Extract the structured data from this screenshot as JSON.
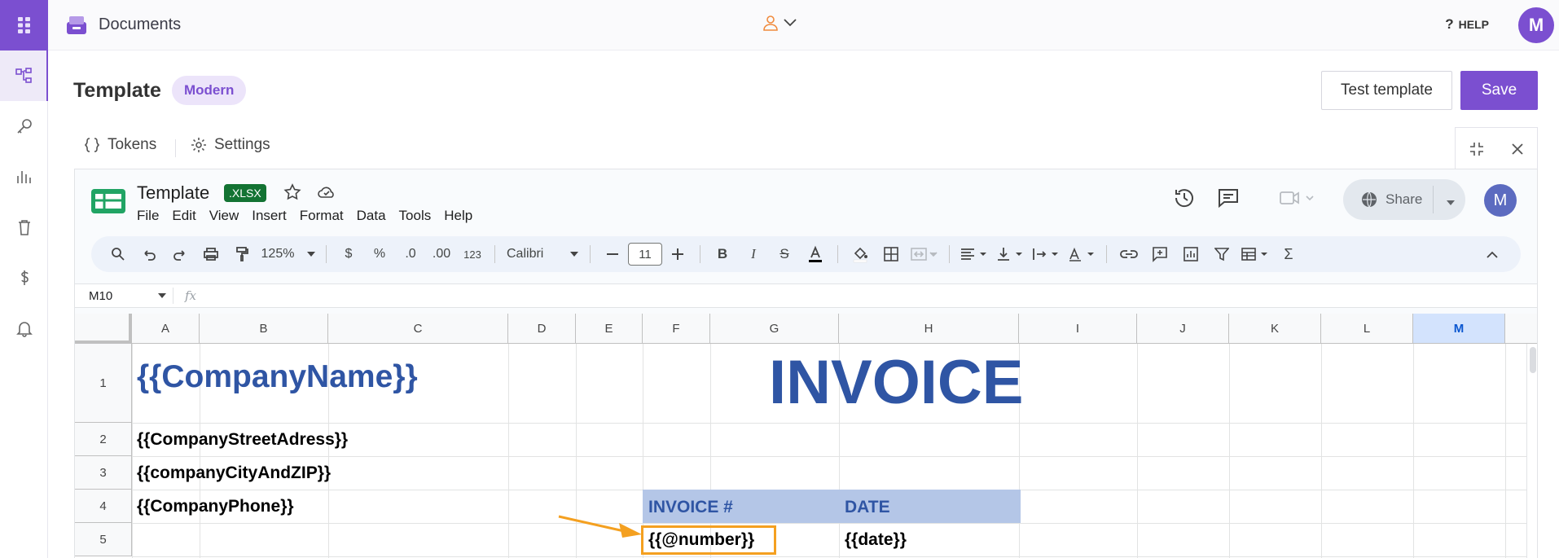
{
  "topbar": {
    "app_title": "Documents",
    "help_label": "HELP",
    "avatar_initial": "M"
  },
  "header": {
    "title": "Template",
    "badge": "Modern",
    "test_button": "Test template",
    "save_button": "Save"
  },
  "tabs": [
    {
      "label": "Tokens",
      "icon": "braces-icon"
    },
    {
      "label": "Settings",
      "icon": "gear-icon"
    }
  ],
  "sheets": {
    "doc_title": "Template",
    "format_badge": ".XLSX",
    "menu": [
      "File",
      "Edit",
      "View",
      "Insert",
      "Format",
      "Data",
      "Tools",
      "Help"
    ],
    "share_label": "Share",
    "avatar_initial": "M",
    "toolbar": {
      "zoom": "125%",
      "currency": "$",
      "percent": "%",
      "dec_decrease": ".0",
      "dec_increase": ".00",
      "number_format": "123",
      "font": "Calibri",
      "font_size": "11"
    },
    "name_box": "M10",
    "fx_label": "fx",
    "columns": [
      "A",
      "B",
      "C",
      "D",
      "E",
      "F",
      "G",
      "H",
      "I",
      "J",
      "K",
      "L",
      "M"
    ],
    "selected_column": "M",
    "rows": [
      "1",
      "2",
      "3",
      "4",
      "5"
    ],
    "cells": {
      "A1": "{{CompanyName}}",
      "G1": "INVOICE",
      "A2": "{{CompanyStreetAdress}}",
      "A3": "{{companyCityAndZIP}}",
      "A4": "{{CompanyPhone}}",
      "F4": "INVOICE #",
      "H4": "DATE",
      "F5": "{{@number}}",
      "H5": "{{date}}"
    }
  },
  "colors": {
    "accent": "#7b4fd0",
    "invoice_blue": "#2f55a4",
    "header_band": "#b4c6e7",
    "highlight": "#f4a020",
    "xlsx_badge": "#137333"
  }
}
